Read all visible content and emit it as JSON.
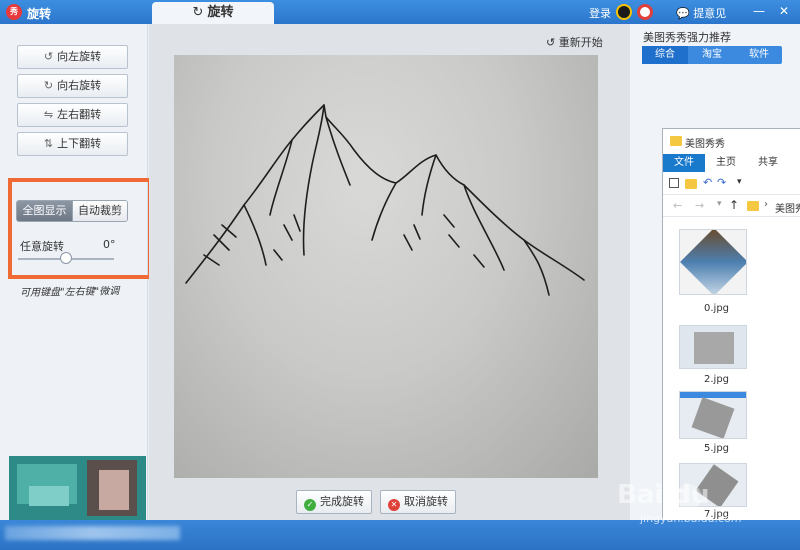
{
  "titlebar": {
    "app_title": "旋转",
    "app_logo_text": "秀",
    "main_tab": "旋转",
    "login": "登录",
    "feedback": "提意见",
    "min_icon": "—",
    "close_icon": "✕"
  },
  "left_panel": {
    "buttons": [
      {
        "label": "向左旋转",
        "icon": "↺"
      },
      {
        "label": "向右旋转",
        "icon": "↻"
      },
      {
        "label": "左右翻转",
        "icon": "⇋"
      },
      {
        "label": "上下翻转",
        "icon": "⇅"
      }
    ],
    "display_modes": {
      "full": "全图显示",
      "auto_crop": "自动裁剪"
    },
    "rotate_label": "任意旋转",
    "rotate_value": "0°",
    "rotate_level": 0.5,
    "hint": "可用键盘\"左右键\"微调"
  },
  "canvas": {
    "reset": "重新开始",
    "reset_icon": "↺",
    "confirm": "完成旋转",
    "confirm_icon": "✓",
    "cancel": "取消旋转",
    "cancel_icon": "✕"
  },
  "right_panel": {
    "title": "美图秀秀强力推荐",
    "tabs": [
      "综合",
      "淘宝",
      "软件"
    ]
  },
  "explorer": {
    "title": "美图秀秀",
    "ribbon_tabs": [
      "文件",
      "主页",
      "共享"
    ],
    "path": "美图秀",
    "path_sep": "›",
    "back_icon": "←",
    "forward_icon": "→",
    "up_icon": "↑",
    "files": [
      "0.jpg",
      "2.jpg",
      "5.jpg",
      "7.jpg"
    ]
  },
  "watermark": {
    "text": "Bai du",
    "sub": "jingyan.baidu.com"
  }
}
